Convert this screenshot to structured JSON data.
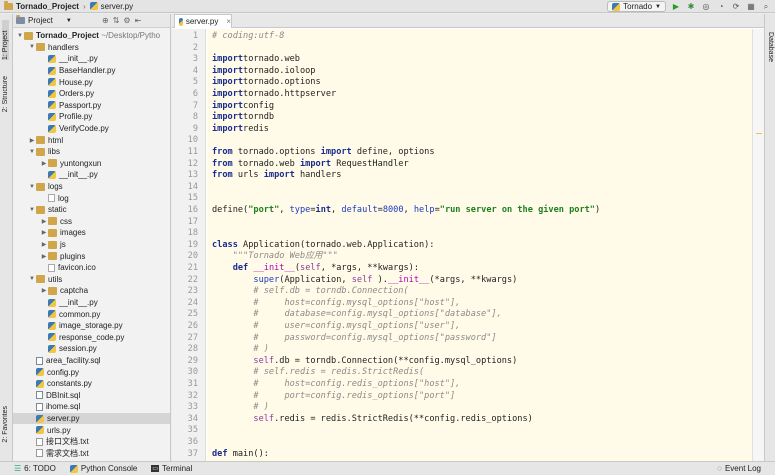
{
  "nav": {
    "project": "Tornado_Project",
    "file": "server.py"
  },
  "run": {
    "config": "Tornado"
  },
  "left_strip": {
    "project_tab": "1: Project",
    "structure_tab": "2: Structure",
    "favorites_tab": "2: Favorites"
  },
  "right_strip": {
    "database_tab": "Database"
  },
  "project_panel": {
    "dropdown": "Project"
  },
  "tree": [
    {
      "depth": 0,
      "arrow": "▼",
      "icon": "f",
      "label": "Tornado_Project",
      "extra": "~/Desktop/Pytho",
      "root": true
    },
    {
      "depth": 1,
      "arrow": "▼",
      "icon": "f",
      "label": "handlers"
    },
    {
      "depth": 2,
      "arrow": "",
      "icon": "py",
      "label": "__init__.py"
    },
    {
      "depth": 2,
      "arrow": "",
      "icon": "py",
      "label": "BaseHandler.py"
    },
    {
      "depth": 2,
      "arrow": "",
      "icon": "py",
      "label": "House.py"
    },
    {
      "depth": 2,
      "arrow": "",
      "icon": "py",
      "label": "Orders.py"
    },
    {
      "depth": 2,
      "arrow": "",
      "icon": "py",
      "label": "Passport.py"
    },
    {
      "depth": 2,
      "arrow": "",
      "icon": "py",
      "label": "Profile.py"
    },
    {
      "depth": 2,
      "arrow": "",
      "icon": "py",
      "label": "VerifyCode.py"
    },
    {
      "depth": 1,
      "arrow": "▶",
      "icon": "f",
      "label": "html"
    },
    {
      "depth": 1,
      "arrow": "▼",
      "icon": "f",
      "label": "libs"
    },
    {
      "depth": 2,
      "arrow": "▶",
      "icon": "f",
      "label": "yuntongxun"
    },
    {
      "depth": 2,
      "arrow": "",
      "icon": "py",
      "label": "__init__.py"
    },
    {
      "depth": 1,
      "arrow": "▼",
      "icon": "f",
      "label": "logs"
    },
    {
      "depth": 2,
      "arrow": "",
      "icon": "file",
      "label": "log"
    },
    {
      "depth": 1,
      "arrow": "▼",
      "icon": "f",
      "label": "static"
    },
    {
      "depth": 2,
      "arrow": "▶",
      "icon": "f",
      "label": "css"
    },
    {
      "depth": 2,
      "arrow": "▶",
      "icon": "f",
      "label": "images"
    },
    {
      "depth": 2,
      "arrow": "▶",
      "icon": "f",
      "label": "js"
    },
    {
      "depth": 2,
      "arrow": "▶",
      "icon": "f",
      "label": "plugins"
    },
    {
      "depth": 2,
      "arrow": "",
      "icon": "fav",
      "label": "favicon.ico"
    },
    {
      "depth": 1,
      "arrow": "▼",
      "icon": "f",
      "label": "utils"
    },
    {
      "depth": 2,
      "arrow": "▶",
      "icon": "f",
      "label": "captcha"
    },
    {
      "depth": 2,
      "arrow": "",
      "icon": "py",
      "label": "__init__.py"
    },
    {
      "depth": 2,
      "arrow": "",
      "icon": "py",
      "label": "common.py"
    },
    {
      "depth": 2,
      "arrow": "",
      "icon": "py",
      "label": "image_storage.py"
    },
    {
      "depth": 2,
      "arrow": "",
      "icon": "py",
      "label": "response_code.py"
    },
    {
      "depth": 2,
      "arrow": "",
      "icon": "py",
      "label": "session.py"
    },
    {
      "depth": 1,
      "arrow": "",
      "icon": "sql",
      "label": "area_facility.sql"
    },
    {
      "depth": 1,
      "arrow": "",
      "icon": "py",
      "label": "config.py"
    },
    {
      "depth": 1,
      "arrow": "",
      "icon": "py",
      "label": "constants.py"
    },
    {
      "depth": 1,
      "arrow": "",
      "icon": "sql",
      "label": "DBInit.sql"
    },
    {
      "depth": 1,
      "arrow": "",
      "icon": "sql",
      "label": "ihome.sql"
    },
    {
      "depth": 1,
      "arrow": "",
      "icon": "py",
      "label": "server.py",
      "selected": true
    },
    {
      "depth": 1,
      "arrow": "",
      "icon": "py",
      "label": "urls.py"
    },
    {
      "depth": 1,
      "arrow": "",
      "icon": "txt",
      "label": "接口文档.txt"
    },
    {
      "depth": 1,
      "arrow": "",
      "icon": "txt",
      "label": "需求文档.txt"
    }
  ],
  "editor": {
    "tab": "server.py"
  },
  "code": [
    [
      [
        "cm",
        "# coding:utf-8"
      ]
    ],
    [],
    [
      [
        "kw",
        "import"
      ],
      [
        "",
        "tornado.web"
      ]
    ],
    [
      [
        "kw",
        "import"
      ],
      [
        "",
        "tornado.ioloop"
      ]
    ],
    [
      [
        "kw",
        "import"
      ],
      [
        "",
        "tornado.options"
      ]
    ],
    [
      [
        "kw",
        "import"
      ],
      [
        "",
        "tornado.httpserver"
      ]
    ],
    [
      [
        "kw",
        "import"
      ],
      [
        "",
        "config"
      ]
    ],
    [
      [
        "kw",
        "import"
      ],
      [
        "",
        "torndb"
      ]
    ],
    [
      [
        "kw",
        "import"
      ],
      [
        "",
        "redis"
      ]
    ],
    [],
    [
      [
        "kw",
        "from"
      ],
      [
        "",
        " tornado.options "
      ],
      [
        "kw",
        "import"
      ],
      [
        "",
        " define, options"
      ]
    ],
    [
      [
        "kw",
        "from"
      ],
      [
        "",
        " tornado.web "
      ],
      [
        "kw",
        "import"
      ],
      [
        "",
        " RequestHandler"
      ]
    ],
    [
      [
        "kw",
        "from"
      ],
      [
        "",
        " urls "
      ],
      [
        "kw",
        "import"
      ],
      [
        "",
        " handlers"
      ]
    ],
    [],
    [],
    [
      [
        "",
        "define("
      ],
      [
        "st",
        "\"port\""
      ],
      [
        "",
        ", "
      ],
      [
        "nm",
        "type"
      ],
      [
        "",
        "="
      ],
      [
        "kw",
        "int"
      ],
      [
        "",
        ", "
      ],
      [
        "nm",
        "default"
      ],
      [
        "",
        "="
      ],
      [
        "nm",
        "8000"
      ],
      [
        "",
        ", "
      ],
      [
        "nm",
        "help"
      ],
      [
        "",
        "="
      ],
      [
        "st",
        "\"run server on the given port\""
      ],
      [
        "",
        ")"
      ]
    ],
    [],
    [],
    [
      [
        "kw",
        "class"
      ],
      [
        "",
        " Application(tornado.web.Application):"
      ]
    ],
    [
      [
        "",
        "    "
      ],
      [
        "cm",
        "\"\"\"Tornado Web应用\"\"\""
      ]
    ],
    [
      [
        "",
        "    "
      ],
      [
        "kw",
        "def"
      ],
      [
        "",
        " "
      ],
      [
        "dn",
        "__init__"
      ],
      [
        "",
        "("
      ],
      [
        "sf",
        "self"
      ],
      [
        "",
        ", *args, **kwargs):"
      ]
    ],
    [
      [
        "",
        "        "
      ],
      [
        "nm",
        "super"
      ],
      [
        "",
        "(Application, "
      ],
      [
        "sf",
        "self"
      ],
      [
        "",
        " )."
      ],
      [
        "dn",
        "__init__"
      ],
      [
        "",
        "(*args, **kwargs)"
      ]
    ],
    [
      [
        "",
        "        "
      ],
      [
        "cm",
        "# self.db = torndb.Connection("
      ]
    ],
    [
      [
        "",
        "        "
      ],
      [
        "cm",
        "#     host=config.mysql_options[\"host\"],"
      ]
    ],
    [
      [
        "",
        "        "
      ],
      [
        "cm",
        "#     database=config.mysql_options[\"database\"],"
      ]
    ],
    [
      [
        "",
        "        "
      ],
      [
        "cm",
        "#     user=config.mysql_options[\"user\"],"
      ]
    ],
    [
      [
        "",
        "        "
      ],
      [
        "cm",
        "#     password=config.mysql_options[\"password\"]"
      ]
    ],
    [
      [
        "",
        "        "
      ],
      [
        "cm",
        "# )"
      ]
    ],
    [
      [
        "",
        "        "
      ],
      [
        "sf",
        "self"
      ],
      [
        "",
        ".db = torndb.Connection(**config.mysql_options)"
      ]
    ],
    [
      [
        "",
        "        "
      ],
      [
        "cm",
        "# self.redis = redis.StrictRedis("
      ]
    ],
    [
      [
        "",
        "        "
      ],
      [
        "cm",
        "#     host=config.redis_options[\"host\"],"
      ]
    ],
    [
      [
        "",
        "        "
      ],
      [
        "cm",
        "#     port=config.redis_options[\"port\"]"
      ]
    ],
    [
      [
        "",
        "        "
      ],
      [
        "cm",
        "# )"
      ]
    ],
    [
      [
        "",
        "        "
      ],
      [
        "sf",
        "self"
      ],
      [
        "",
        ".redis = redis.StrictRedis(**config.redis_options)"
      ]
    ],
    [],
    [],
    [
      [
        "kw",
        "def"
      ],
      [
        "",
        " main():"
      ]
    ]
  ],
  "status": {
    "todo": "6: TODO",
    "console": "Python Console",
    "terminal": "Terminal",
    "event_log": "Event Log"
  }
}
